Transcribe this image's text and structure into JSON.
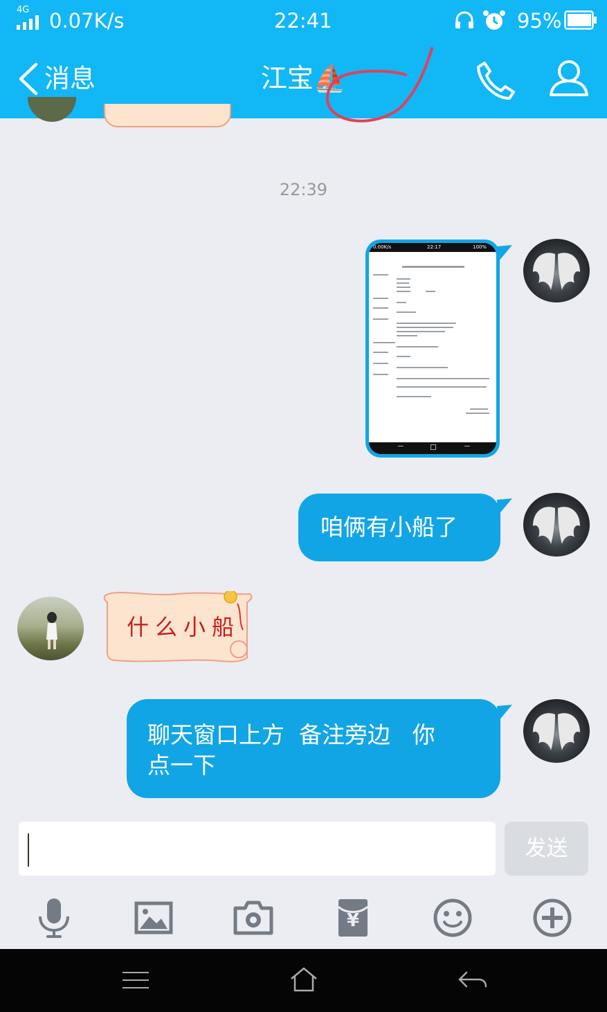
{
  "status_bar": {
    "network": "4G",
    "speed": "0.07K/s",
    "time": "22:41",
    "battery": "95%"
  },
  "header": {
    "back_label": "消息",
    "title": "江宝⛵"
  },
  "chat": {
    "timestamp": "22:39",
    "messages": [
      {
        "from": "me",
        "type": "image",
        "screenshot": {
          "speed": "0.00K/s",
          "time": "22:17",
          "battery": "100%"
        }
      },
      {
        "from": "me",
        "type": "text",
        "text": "咱俩有小船了"
      },
      {
        "from": "other",
        "type": "sticker",
        "text": "什么小船"
      },
      {
        "from": "me",
        "type": "text",
        "text_line1": "聊天窗口上方  备注旁边   你",
        "text_line2": "点一下"
      }
    ]
  },
  "input": {
    "value": "",
    "send_label": "发送"
  },
  "toolbar": {
    "icons": [
      "microphone-icon",
      "image-icon",
      "camera-icon",
      "red-packet-icon",
      "emoji-icon",
      "plus-icon"
    ],
    "red_packet_symbol": "¥"
  },
  "colors": {
    "accent": "#12b7f5",
    "bubble": "#12a5e6",
    "background": "#ebedf2",
    "annotation": "#e0415a"
  }
}
